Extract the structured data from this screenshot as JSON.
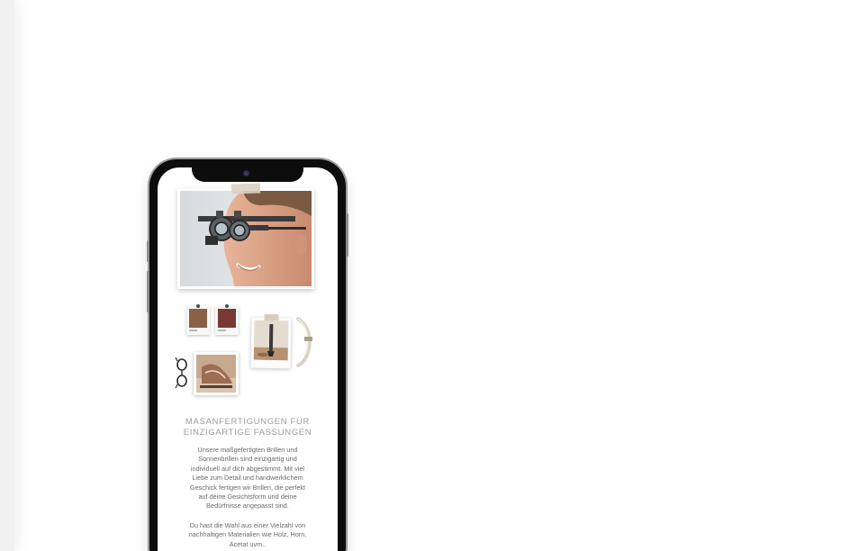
{
  "colors": {
    "page_background": "#ffffff",
    "phone_frame": "#0d0d0d",
    "swatch_brown": "#8a6147",
    "swatch_burgundy": "#7a3a34",
    "heading_gray": "#9c9c9c",
    "body_gray": "#6a6a6a"
  },
  "icons": {
    "camera": "camera-icon",
    "glasses": "glasses-icon"
  },
  "content": {
    "headline": "MASANFERTIGUNGEN FÜR\nEINZIGARTIGE FASSUNGEN",
    "paragraph_1": "Unsere maßgefertigten Brillen und\nSonnenbrillen sind einzigartig und\nindividuell auf dich abgestimmt. Mit viel\nLiebe zum Detail und handwerklichem\nGeschick fertigen wir Brillen, die perfekt\nauf deine Gesichtsform und deine\nBedürfnisse angepasst sind.",
    "paragraph_2": "Du hast die Wahl aus einer Vielzahl von\nnachhaltigen Materialien wie Holz, Horn,\nAcetat uvm.."
  }
}
